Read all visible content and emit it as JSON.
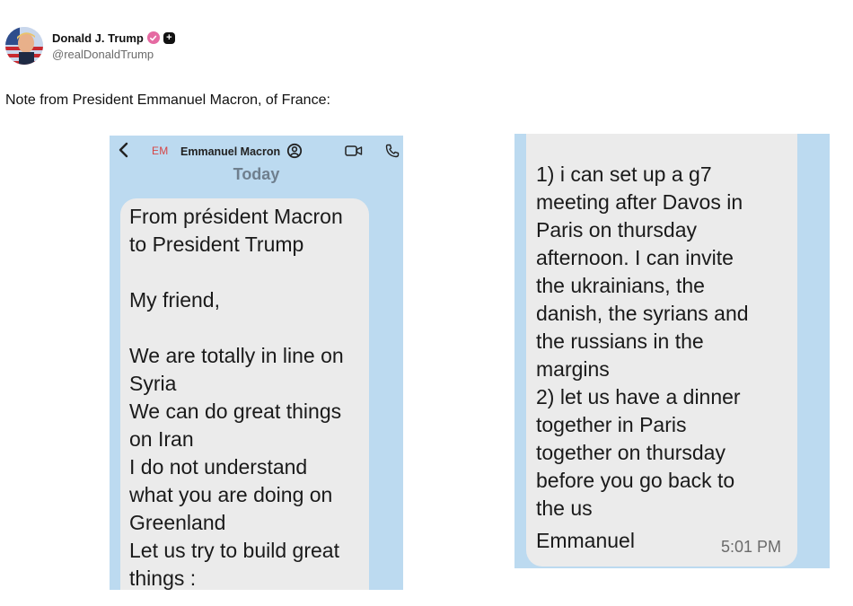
{
  "post": {
    "author_name": "Donald J. Trump",
    "author_handle": "@realDonaldTrump",
    "text": "Note from President Emmanuel Macron, of France:"
  },
  "left_screenshot": {
    "contact_initials": "EM",
    "contact_name": "Emmanuel Macron",
    "date_label": "Today",
    "message": "From président Macron\nto President Trump\n\nMy friend,\n\nWe are totally in line on\nSyria\nWe can do great things\non Iran\nI do not understand\nwhat you are doing on\nGreenland\nLet us try to build great\nthings :"
  },
  "right_screenshot": {
    "message": "1) i can set up a g7\nmeeting after Davos in\nParis on thursday\nafternoon. I can invite\nthe ukrainians, the\ndanish, the syrians and\nthe russians in the\nmargins\n2) let us have a dinner\ntogether in Paris\ntogether on thursday\nbefore you go back to\nthe us",
    "signature": "Emmanuel",
    "time": "5:01 PM"
  },
  "icons": {
    "avatar": "profile-photo",
    "verified": "verified-badge-icon",
    "plus": "plus-badge-icon",
    "back": "chevron-left-icon",
    "contact": "contact-card-icon",
    "video": "video-camera-icon",
    "phone": "phone-icon"
  },
  "colors": {
    "screenshot_background": "#bcdaf0",
    "bubble": "#ebebeb",
    "verified_badge": "#e56aa2",
    "initials": "#d64545"
  }
}
